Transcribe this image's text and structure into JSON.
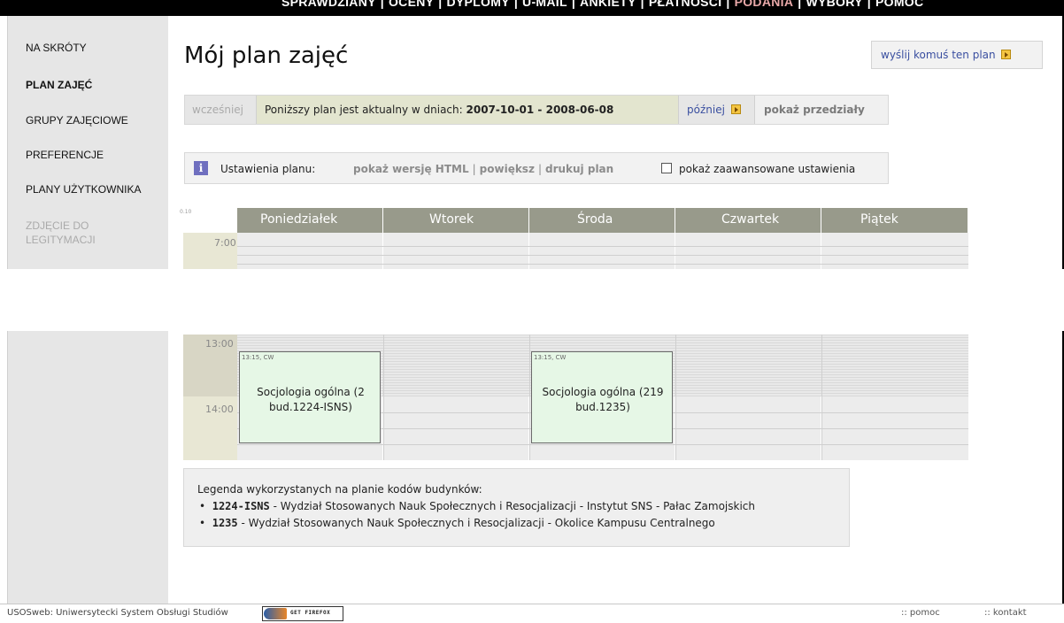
{
  "top_menu": {
    "items": [
      {
        "label": "SPRAWDZIANY",
        "active": false
      },
      {
        "label": "OCENY",
        "active": false
      },
      {
        "label": "DYPLOMY",
        "active": false
      },
      {
        "label": "U-MAIL",
        "active": false
      },
      {
        "label": "ANKIETY",
        "active": false
      },
      {
        "label": "PŁATNOŚCI",
        "active": false
      },
      {
        "label": "PODANIA",
        "active": true
      },
      {
        "label": "WYBORY",
        "active": false
      },
      {
        "label": "POMOC",
        "active": false
      }
    ],
    "separator": "|"
  },
  "sidebar": {
    "items": [
      {
        "label": "NA SKRÓTY"
      },
      {
        "label": "PLAN ZAJĘĆ"
      },
      {
        "label": "GRUPY ZAJĘCIOWE"
      },
      {
        "label": "PREFERENCJE"
      },
      {
        "label": "PLANY UŻYTKOWNIKA"
      },
      {
        "label": "ZDJĘCIE DO LEGITYMACJI"
      }
    ]
  },
  "page": {
    "title": "Mój plan zajęć",
    "send_plan_label": "wyślij komuś ten plan"
  },
  "date_bar": {
    "earlier": "wcześniej",
    "range_text": "Poniższy plan jest aktualny w dniach: ",
    "range_value": "2007-10-01 - 2008-06-08",
    "later": "później",
    "show_intervals": "pokaż przedziały"
  },
  "settings": {
    "info_glyph": "i",
    "label": "Ustawienia planu:",
    "links": [
      "pokaż wersję HTML",
      "powiększ",
      "drukuj plan"
    ],
    "separator": "|",
    "advanced_label": "pokaż zaawansowane ustawienia",
    "advanced_checked": false
  },
  "calendar": {
    "corner_label": "0.10",
    "days": [
      "Poniedziałek",
      "Wtorek",
      "Środa",
      "Czwartek",
      "Piątek"
    ],
    "times": [
      "7:00",
      "13:00",
      "14:00"
    ],
    "events": [
      {
        "time": "13:15, CW",
        "line1": "Socjologia ogólna (2",
        "line2": "bud.1224-ISNS)"
      },
      {
        "time": "13:15, CW",
        "line1": "Socjologia ogólna (219",
        "line2": "bud.1235)"
      }
    ]
  },
  "legend": {
    "heading": "Legenda wykorzystanych na planie kodów budynków:",
    "entries": [
      {
        "code": "1224-ISNS",
        "desc": " - Wydział Stosowanych Nauk Społecznych i Resocjalizacji - Instytut SNS - Pałac Zamojskich"
      },
      {
        "code": "1235",
        "desc": " - Wydział Stosowanych Nauk Społecznych i Resocjalizacji - Okolice Kampusu Centralnego"
      }
    ]
  },
  "footer": {
    "system_name": "USOSweb: Uniwersytecki System Obsługi Studiów",
    "firefox_badge": "GET FIREFOX",
    "help": ":: pomoc",
    "contact": ":: kontakt"
  }
}
